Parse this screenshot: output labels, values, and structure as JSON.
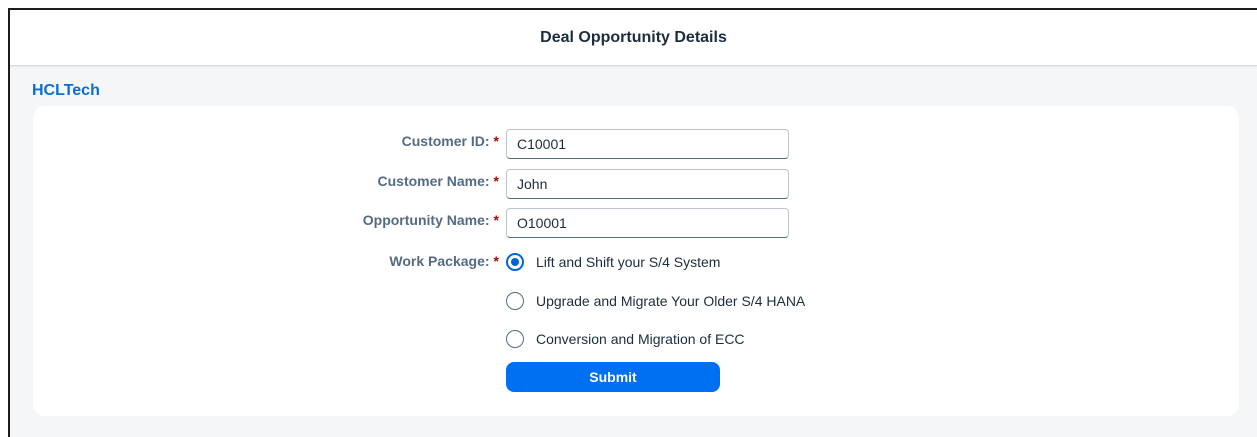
{
  "header": {
    "title": "Deal Opportunity Details"
  },
  "brand": {
    "name": "HCLTech"
  },
  "form": {
    "required_mark": "*",
    "customer_id": {
      "label": "Customer ID:",
      "value": "C10001"
    },
    "customer_name": {
      "label": "Customer Name:",
      "value": "John"
    },
    "opportunity_name": {
      "label": "Opportunity Name:",
      "value": "O10001"
    },
    "work_package": {
      "label": "Work Package:",
      "selected_index": 0,
      "options": [
        "Lift and Shift your S/4 System",
        "Upgrade and Migrate Your Older S/4 HANA",
        "Conversion and Migration of ECC"
      ]
    },
    "submit_label": "Submit"
  },
  "colors": {
    "accent": "#0070f2",
    "brand": "#0a6ed1",
    "required": "#aa0808",
    "label": "#556b82"
  }
}
